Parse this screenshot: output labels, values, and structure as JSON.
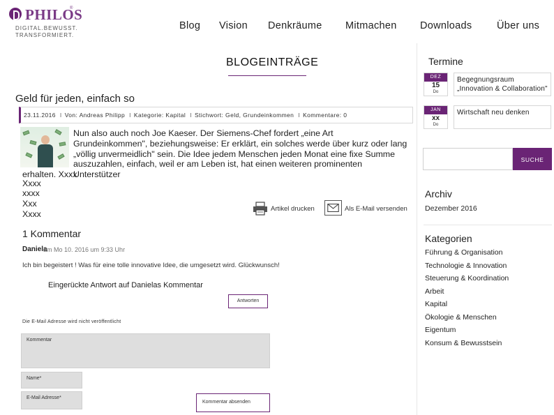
{
  "logo": {
    "word": "PHILOS",
    "reg": "®",
    "tagline_1": "DIGITAL.BEWUSST.",
    "tagline_2": "TRANSFORMIERT."
  },
  "nav": [
    "Blog",
    "Vision",
    "Denkräume",
    "Mitmachen",
    "Downloads",
    "Über uns"
  ],
  "blog": {
    "heading": "BLOGEINTRÄGE",
    "post_title": "Geld für jeden, einfach so",
    "meta": {
      "date": "23.11.2016",
      "author": "Von: Andreas Philipp",
      "category": "Kategorie: Kapital",
      "keywords": "Stichwort: Geld, Grundeinkommen",
      "comments": "Kommentare: 0",
      "sep": "I"
    },
    "text_1": "Nun also auch noch Joe Kaeser. Der Siemens-Chef fordert „eine Art Grundeinkommen\", beziehungsweise: Er erklärt, ein solches werde über kurz oder lang „völlig unvermeidlich\" sein. Die Idee jedem Menschen jeden Monat eine fixe Summe auszuzahlen, einfach, weil er am Leben ist, hat einen weiteren prominenten Unterstützer",
    "text_2": "erhalten. Xxxx",
    "extra_lines": [
      "Xxxx",
      "xxxx",
      "Xxx",
      "Xxxx"
    ],
    "print_label": "Artikel drucken",
    "mail_label": "Als E-Mail versenden"
  },
  "comments": {
    "count": "1 Kommentar",
    "author": "Daniela",
    "date": "am Mo 10. 2016 um 9:33 Uhr",
    "text": "Ich bin begeistert ! Was für eine tolle innovative Idee, die umgesetzt wird. Glückwunsch!",
    "reply_title": "Eingerückte Antwort auf Danielas Kommentar",
    "reply_button": "Antworten",
    "privacy": "Die E-Mail Adresse wird nicht veröffentlicht",
    "comment_label": "Kommentar",
    "name_label": "Name*",
    "email_label": "E-Mail Adresse*",
    "submit": "Kommentar absenden"
  },
  "sidebar": {
    "termine_title": "Termine",
    "events": [
      {
        "month": "DEZ",
        "day": "15",
        "weekday": "Do",
        "title_1": "Begegnungsraum",
        "title_2": "„Innovation & Collaboration\""
      },
      {
        "month": "JAN",
        "day": "xx",
        "weekday": "Do",
        "title_1": "Wirtschaft neu denken",
        "title_2": ""
      }
    ],
    "search_button": "SUCHE",
    "archive_title": "Archiv",
    "archive_item": "Dezember 2016",
    "categories_title": "Kategorien",
    "categories": [
      "Führung & Organisation",
      "Technologie & Innovation",
      "Steuerung & Koordination",
      "Arbeit",
      "Kapital",
      "Ökologie & Menschen",
      "Eigentum",
      "Konsum & Bewusstsein"
    ]
  },
  "colors": {
    "accent": "#6a2475",
    "input_bg": "#dedede"
  }
}
